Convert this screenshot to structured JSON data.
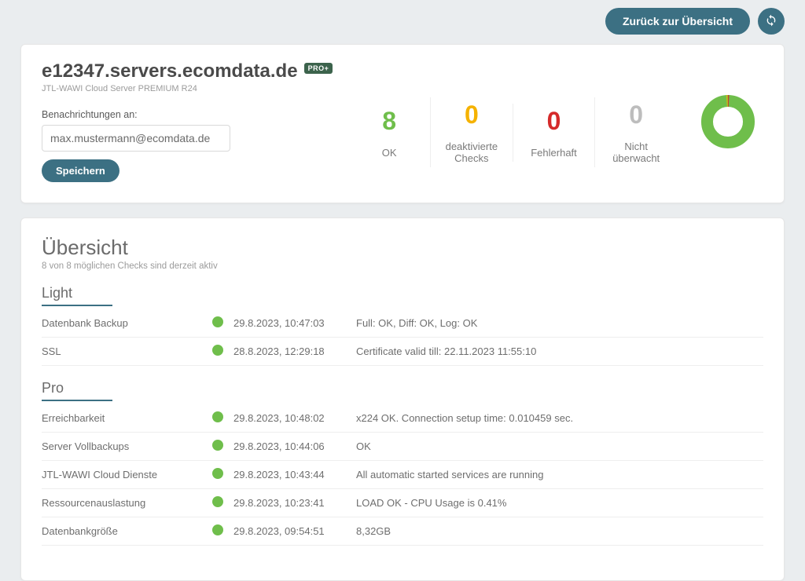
{
  "topbar": {
    "back_label": "Zurück zur Übersicht"
  },
  "header": {
    "server_title": "e12347.servers.ecomdata.de",
    "badge": "PRO+",
    "subtitle": "JTL-WAWI Cloud Server PREMIUM R24",
    "notify_label": "Benachrichtungen an:",
    "email_value": "max.mustermann@ecomdata.de",
    "save_label": "Speichern"
  },
  "metrics": [
    {
      "value": "8",
      "label": "OK",
      "color": "green"
    },
    {
      "value": "0",
      "label": "deaktivierte Checks",
      "color": "amber"
    },
    {
      "value": "0",
      "label": "Fehlerhaft",
      "color": "red"
    },
    {
      "value": "0",
      "label": "Nicht überwacht",
      "color": "grey"
    }
  ],
  "overview": {
    "title": "Übersicht",
    "subtitle": "8 von 8 möglichen Checks sind derzeit aktiv"
  },
  "sections": [
    {
      "title": "Light",
      "rows": [
        {
          "name": "Datenbank Backup",
          "ts": "29.8.2023, 10:47:03",
          "msg": "Full: OK, Diff: OK, Log: OK"
        },
        {
          "name": "SSL",
          "ts": "28.8.2023, 12:29:18",
          "msg": "Certificate valid till: 22.11.2023 11:55:10"
        }
      ]
    },
    {
      "title": "Pro",
      "rows": [
        {
          "name": "Erreichbarkeit",
          "ts": "29.8.2023, 10:48:02",
          "msg": "x224 OK. Connection setup time: 0.010459 sec."
        },
        {
          "name": "Server Vollbackups",
          "ts": "29.8.2023, 10:44:06",
          "msg": "OK"
        },
        {
          "name": "JTL-WAWI Cloud Dienste",
          "ts": "29.8.2023, 10:43:44",
          "msg": "All automatic started services are running"
        },
        {
          "name": "Ressourcenauslastung",
          "ts": "29.8.2023, 10:23:41",
          "msg": "LOAD OK - CPU Usage is 0.41%"
        },
        {
          "name": "Datenbankgröße",
          "ts": "29.8.2023, 09:54:51",
          "msg": "8,32GB"
        }
      ]
    }
  ],
  "chart_data": {
    "type": "pie",
    "title": "Check status distribution",
    "series": [
      {
        "name": "OK",
        "value": 8,
        "color": "#6fbe4b"
      },
      {
        "name": "deaktivierte Checks",
        "value": 0,
        "color": "#f5b200"
      },
      {
        "name": "Fehlerhaft",
        "value": 0,
        "color": "#d52a2a"
      },
      {
        "name": "Nicht überwacht",
        "value": 0,
        "color": "#bdbdbd"
      }
    ]
  }
}
